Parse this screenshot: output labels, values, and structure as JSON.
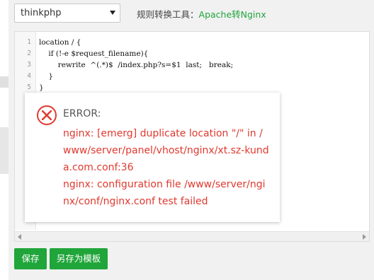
{
  "top_bar": {
    "select_value": "thinkphp",
    "tool_label": "规则转换工具：",
    "tool_link": "Apache转Nginx"
  },
  "editor": {
    "line_numbers": [
      "1",
      "2",
      "3",
      "4",
      "5"
    ],
    "lines": [
      "location / {",
      "    if (!-e $request_filename){",
      "        rewrite  ^(.*)$  /index.php?s=$1  last;   break;",
      "    }",
      "}"
    ]
  },
  "buttons": {
    "save": "保存",
    "save_as_template": "另存为模板"
  },
  "error_dialog": {
    "title": "ERROR:",
    "message_1": "nginx: [emerg] duplicate location \"/\" in /www/server/panel/vhost/nginx/xt.sz-kunda.com.conf:36",
    "message_2": "nginx: configuration file /www/server/nginx/conf/nginx.conf test failed"
  },
  "colors": {
    "accent_green": "#20a53a",
    "error_red": "#e0392f"
  },
  "icons": {
    "error": "error-circle-x-icon",
    "select_arrow": "caret-down-icon",
    "scroll_left": "arrow-left-icon",
    "scroll_right": "arrow-right-icon"
  }
}
